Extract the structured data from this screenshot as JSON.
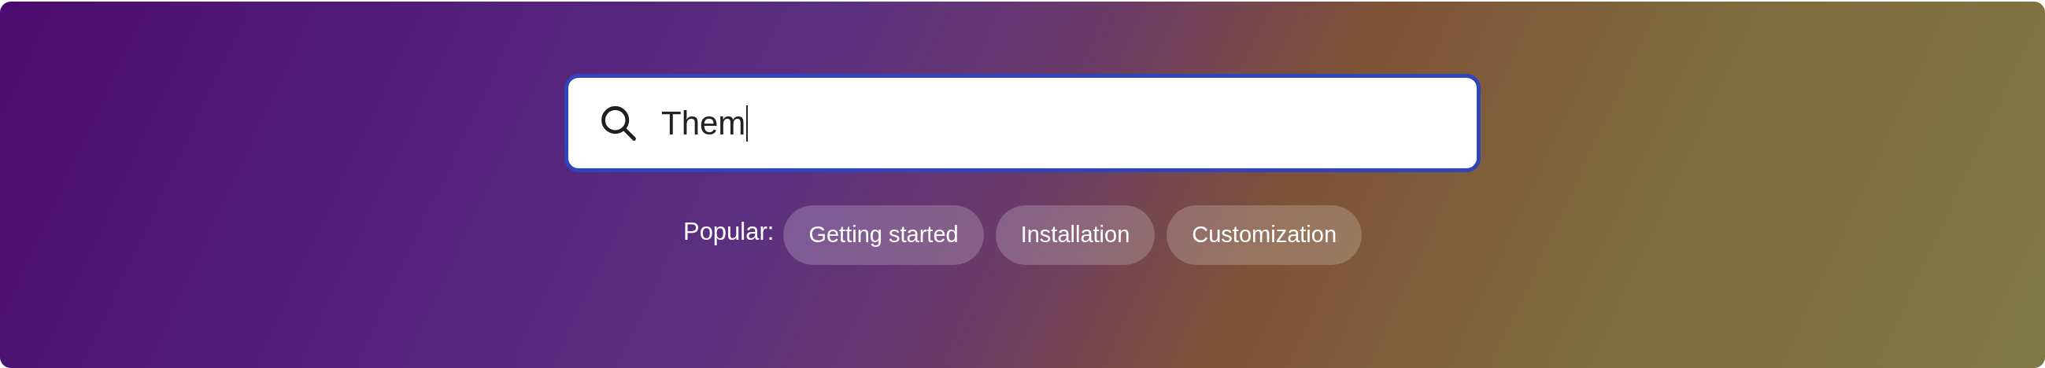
{
  "search": {
    "value": "Them",
    "focused": true
  },
  "popular": {
    "label": "Popular:",
    "chips": [
      "Getting started",
      "Installation",
      "Customization"
    ]
  }
}
